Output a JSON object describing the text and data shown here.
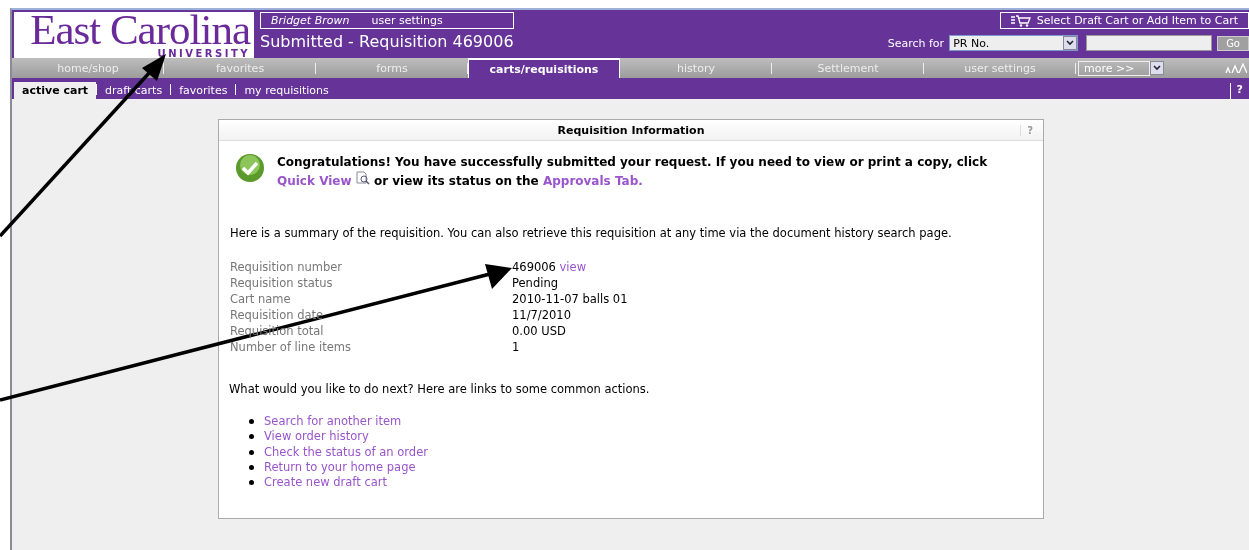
{
  "header": {
    "logo": {
      "name": "East Carolina",
      "subtitle": "UNIVERSITY"
    },
    "user_name": "Bridget Brown",
    "user_settings_link": "user settings",
    "page_title": "Submitted - Requisition 469006",
    "cart_button": "Select Draft Cart or Add Item to Cart",
    "search": {
      "label": "Search for",
      "scope": "PR No.",
      "button": "Go"
    }
  },
  "tabs": [
    {
      "label": "home/shop",
      "selected": false
    },
    {
      "label": "favorites",
      "selected": false
    },
    {
      "label": "forms",
      "selected": false
    },
    {
      "label": "carts/requisitions",
      "selected": true
    },
    {
      "label": "history",
      "selected": false
    },
    {
      "label": "Settlement",
      "selected": false
    },
    {
      "label": "user settings",
      "selected": false
    }
  ],
  "more_select": "more >>",
  "subtabs": [
    {
      "label": "active cart",
      "selected": true
    },
    {
      "label": "draft carts",
      "selected": false
    },
    {
      "label": "favorites",
      "selected": false
    },
    {
      "label": "my requisitions",
      "selected": false
    }
  ],
  "help": "?",
  "panel": {
    "title": "Requisition Information",
    "help": "?",
    "message": "Congratulations! You have successfully submitted your request. If you need to view or print a copy, click",
    "quick_view": "Quick View",
    "message_mid": "or view its status on the",
    "approvals_link": "Approvals Tab.",
    "summary": "Here is a summary of the requisition. You can also retrieve this requisition at any time via the document history search page.",
    "fields": [
      {
        "label": "Requisition number",
        "value": "469006",
        "link": "view"
      },
      {
        "label": "Requisition status",
        "value": "Pending"
      },
      {
        "label": "Cart name",
        "value": "2010-11-07 balls 01"
      },
      {
        "label": "Requisition date",
        "value": "11/7/2010"
      },
      {
        "label": "Requisition total",
        "value": "0.00 USD"
      },
      {
        "label": "Number of line items",
        "value": "1"
      }
    ],
    "next_prompt": "What would you like to do next? Here are links to some common actions.",
    "actions": [
      "Search for another item",
      "View order history",
      "Check the status of an order",
      "Return to your home page",
      "Create new draft cart"
    ]
  }
}
